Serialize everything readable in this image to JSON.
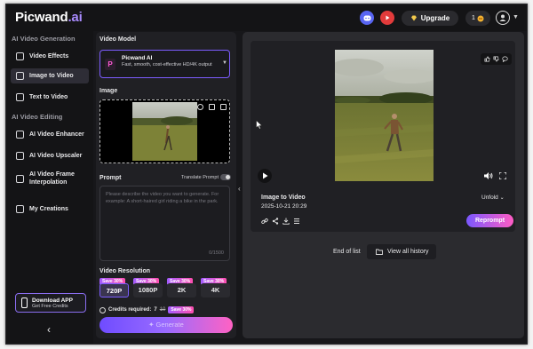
{
  "app": {
    "logo_main": "Picwand",
    "logo_suffix": ".ai"
  },
  "topbar": {
    "upgrade_label": "Upgrade",
    "credits": "1"
  },
  "sidebar": {
    "section_generation": "AI Video Generation",
    "items_generation": [
      {
        "label": "Video Effects",
        "icon": "video-effects-icon"
      },
      {
        "label": "Image to Video",
        "icon": "image-icon",
        "active": true
      },
      {
        "label": "Text to Video",
        "icon": "text-icon"
      }
    ],
    "section_editing": "AI Video Editing",
    "items_editing": [
      {
        "label": "AI Video Enhancer",
        "icon": "enhancer-icon"
      },
      {
        "label": "AI Video Upscaler",
        "icon": "upscaler-icon"
      },
      {
        "label": "AI Video Frame Interpolation",
        "icon": "frame-icon"
      }
    ],
    "creations": {
      "label": "My Creations",
      "icon": "folder-icon"
    },
    "download": {
      "title": "Download APP",
      "subtitle": "Get Free Credits"
    }
  },
  "panel": {
    "model_label": "Video Model",
    "model": {
      "name": "Picwand AI",
      "description": "Fast, smooth, cost-effective HD/4K output"
    },
    "image_label": "Image",
    "prompt_label": "Prompt",
    "translate_label": "Translate Prompt",
    "prompt_placeholder": "Please describe the video you want to generate. For example: A short-haired girl riding a bike in the park.",
    "prompt_count": "0/1500",
    "resolution_label": "Video Resolution",
    "resolutions": [
      {
        "label": "720P",
        "badge": "Save 30%",
        "selected": true
      },
      {
        "label": "1080P",
        "badge": "Save 30%"
      },
      {
        "label": "2K",
        "badge": "Save 30%"
      },
      {
        "label": "4K",
        "badge": "Save 30%"
      }
    ],
    "credits_label": "Credits required:",
    "credits_value": "7",
    "credits_old": "10",
    "credits_badge": "Save 30%",
    "generate_label": "✦ Generate"
  },
  "result": {
    "title": "Image to Video",
    "date": "2025-10-21 20:29",
    "unfold_label": "Unfold",
    "reprompt_label": "Reprompt",
    "end_of_list": "End of list",
    "history_label": "View all history"
  },
  "colors": {
    "accent": "#7c5cff",
    "pink": "#ff5cc4",
    "bg": "#17171a"
  }
}
